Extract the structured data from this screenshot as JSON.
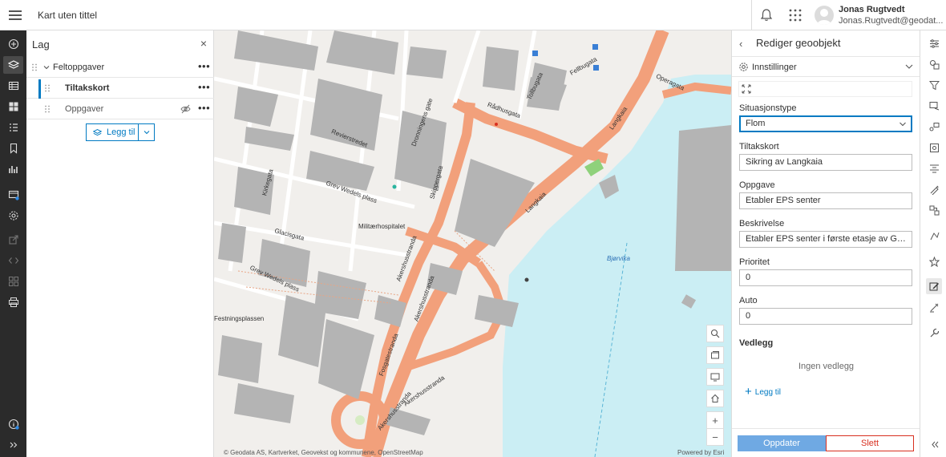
{
  "header": {
    "title": "Kart uten tittel",
    "user_name": "Jonas Rugtvedt",
    "user_email": "Jonas.Rugtvedt@geodat..."
  },
  "left_rail": {
    "icons": [
      "add-icon",
      "layers-icon",
      "table-icon",
      "basemap-icon",
      "legend-icon",
      "bookmark-icon",
      "chart-icon",
      "ready-icon",
      "settings-icon",
      "share-icon",
      "embed-icon",
      "media-icon",
      "print-icon",
      "info-icon",
      "expand-icon"
    ]
  },
  "layers": {
    "title": "Lag",
    "group": {
      "label": "Feltoppgaver"
    },
    "items": [
      {
        "label": "Tiltakskort",
        "selected": true
      },
      {
        "label": "Oppgaver",
        "hidden": true
      }
    ],
    "add_label": "Legg til"
  },
  "map": {
    "labels": {
      "radhusgata": "Rådhusgata",
      "revierstredet": "Revierstredet",
      "grev_wedels_plass": "Grev Wedels plass",
      "grev_wedels_plass2": "Grev Wedels plass",
      "kirkegata": "Kirkegata",
      "glacisgata": "Glacisgata",
      "militaerhospitalet": "Militærhospitalet",
      "festningsplassen": "Festningsplassen",
      "akershusstranda": "Akershusstranda",
      "akershusstranda2": "Akershusstranda",
      "akershusstranda3": "Akershusstranda",
      "langkaia": "Langkaia",
      "langkaia2": "Langkaia",
      "operagata": "Operagata",
      "tollbugata": "Tollbugata",
      "fellbugata": "Fellbugata",
      "bjorvika": "Bjørvika",
      "skippergata": "Skippergata",
      "dronningens_gate": "Dronningens gate",
      "fosgatestranda": "Fosgatestranda",
      "akershusstranda_s": "Akershusstranda"
    },
    "attribution": "© Geodata AS, Kartverket, Geovekst og kommunene, OpenStreetMap",
    "powered": "Powered by Esri",
    "controls": [
      "search-icon",
      "basemap-toggle-icon",
      "screen-icon",
      "home-icon",
      "zoom-in-icon",
      "zoom-out-icon"
    ],
    "zoom_in": "+",
    "zoom_out": "−",
    "colors": {
      "water": "#cbeef4",
      "road": "#f2a07b",
      "building": "#b4b4b4",
      "land": "#f1efec"
    }
  },
  "edit": {
    "title": "Rediger geoobjekt",
    "settings_label": "Innstillinger",
    "fields": [
      {
        "label": "Situasjonstype",
        "value": "Flom",
        "type": "select"
      },
      {
        "label": "Tiltakskort",
        "value": "Sikring av Langkaia"
      },
      {
        "label": "Oppgave",
        "value": "Etabler EPS senter"
      },
      {
        "label": "Beskrivelse",
        "value": "Etabler EPS senter i første etasje av Grew We ..."
      },
      {
        "label": "Prioritet",
        "value": "0"
      },
      {
        "label": "Auto",
        "value": "0"
      }
    ],
    "attachments_title": "Vedlegg",
    "no_attachments": "Ingen vedlegg",
    "add_attachment": "Legg til",
    "update_label": "Oppdater",
    "delete_label": "Slett",
    "accent": "#007ac2",
    "danger": "#d83020"
  },
  "right_rail": {
    "icons": [
      "properties-icon",
      "style-icon",
      "filter-icon",
      "effects-icon",
      "pop-ups-icon",
      "configure-icon",
      "labels-icon",
      "sketch-icon",
      "analysis-icon",
      "directions-icon",
      "measure-icon",
      "edit-icon",
      "draw-icon",
      "tools-icon",
      "collapse-icon"
    ]
  }
}
